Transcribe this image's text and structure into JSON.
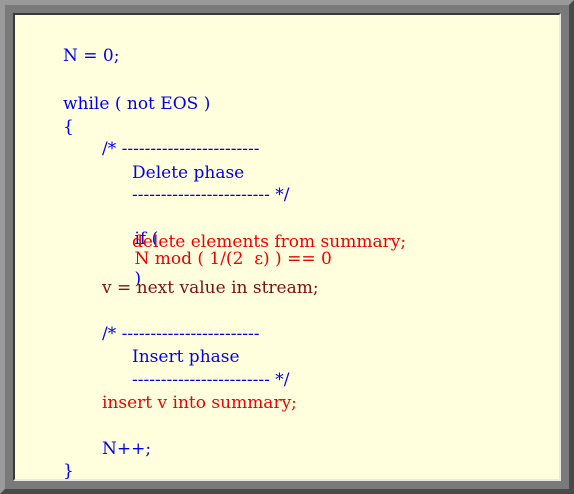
{
  "code": {
    "line1": "N = 0;",
    "line2": "while ( not EOS )",
    "line3": "{",
    "line4": "/* ------------------------",
    "line5": "Delete phase",
    "line6": "------------------------ */",
    "line7a": "if (",
    "line7b": "N mod ( 1/(2  ε) ) == 0",
    "line7c": ")",
    "line8": "delete elements from summary;",
    "line9": "v = next value in stream;",
    "line10": "/* ------------------------",
    "line11": "Insert phase",
    "line12": "------------------------ */",
    "line13": "insert v into summary;",
    "line14": "N++;",
    "line15": "}"
  },
  "colors": {
    "background": "#ffffdd",
    "keyword": "#0000ee",
    "statement": "#7a1010",
    "highlight": "#ee0000"
  }
}
